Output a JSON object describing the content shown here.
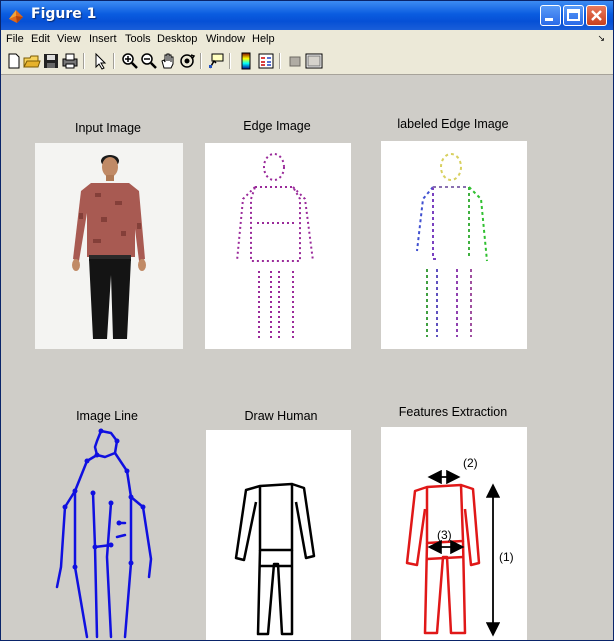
{
  "window": {
    "title": "Figure 1",
    "colors": {
      "titlebar": "#0a5ce0",
      "canvas": "#cfcdc8",
      "menubar": "#ece9d8"
    }
  },
  "menu": {
    "items": [
      "File",
      "Edit",
      "View",
      "Insert",
      "Tools",
      "Desktop",
      "Window",
      "Help"
    ]
  },
  "toolbar": {
    "icons": [
      "new-figure-icon",
      "open-file-icon",
      "save-icon",
      "print-icon",
      "edit-plot-icon",
      "zoom-in-icon",
      "zoom-out-icon",
      "pan-icon",
      "rotate-3d-icon",
      "data-cursor-icon",
      "colorbar-icon",
      "legend-icon",
      "hide-plot-tools-icon",
      "show-plot-tools-icon"
    ]
  },
  "panels": {
    "input_image": {
      "title": "Input Image"
    },
    "edge_image": {
      "title": "Edge Image"
    },
    "labeled_edge_image": {
      "title": "labeled Edge Image"
    },
    "image_line": {
      "title": "Image Line"
    },
    "draw_human": {
      "title": "Draw Human"
    },
    "features_extraction": {
      "title": "Features Extraction",
      "labels": [
        "(2)",
        "(3)",
        "(1)"
      ]
    }
  }
}
